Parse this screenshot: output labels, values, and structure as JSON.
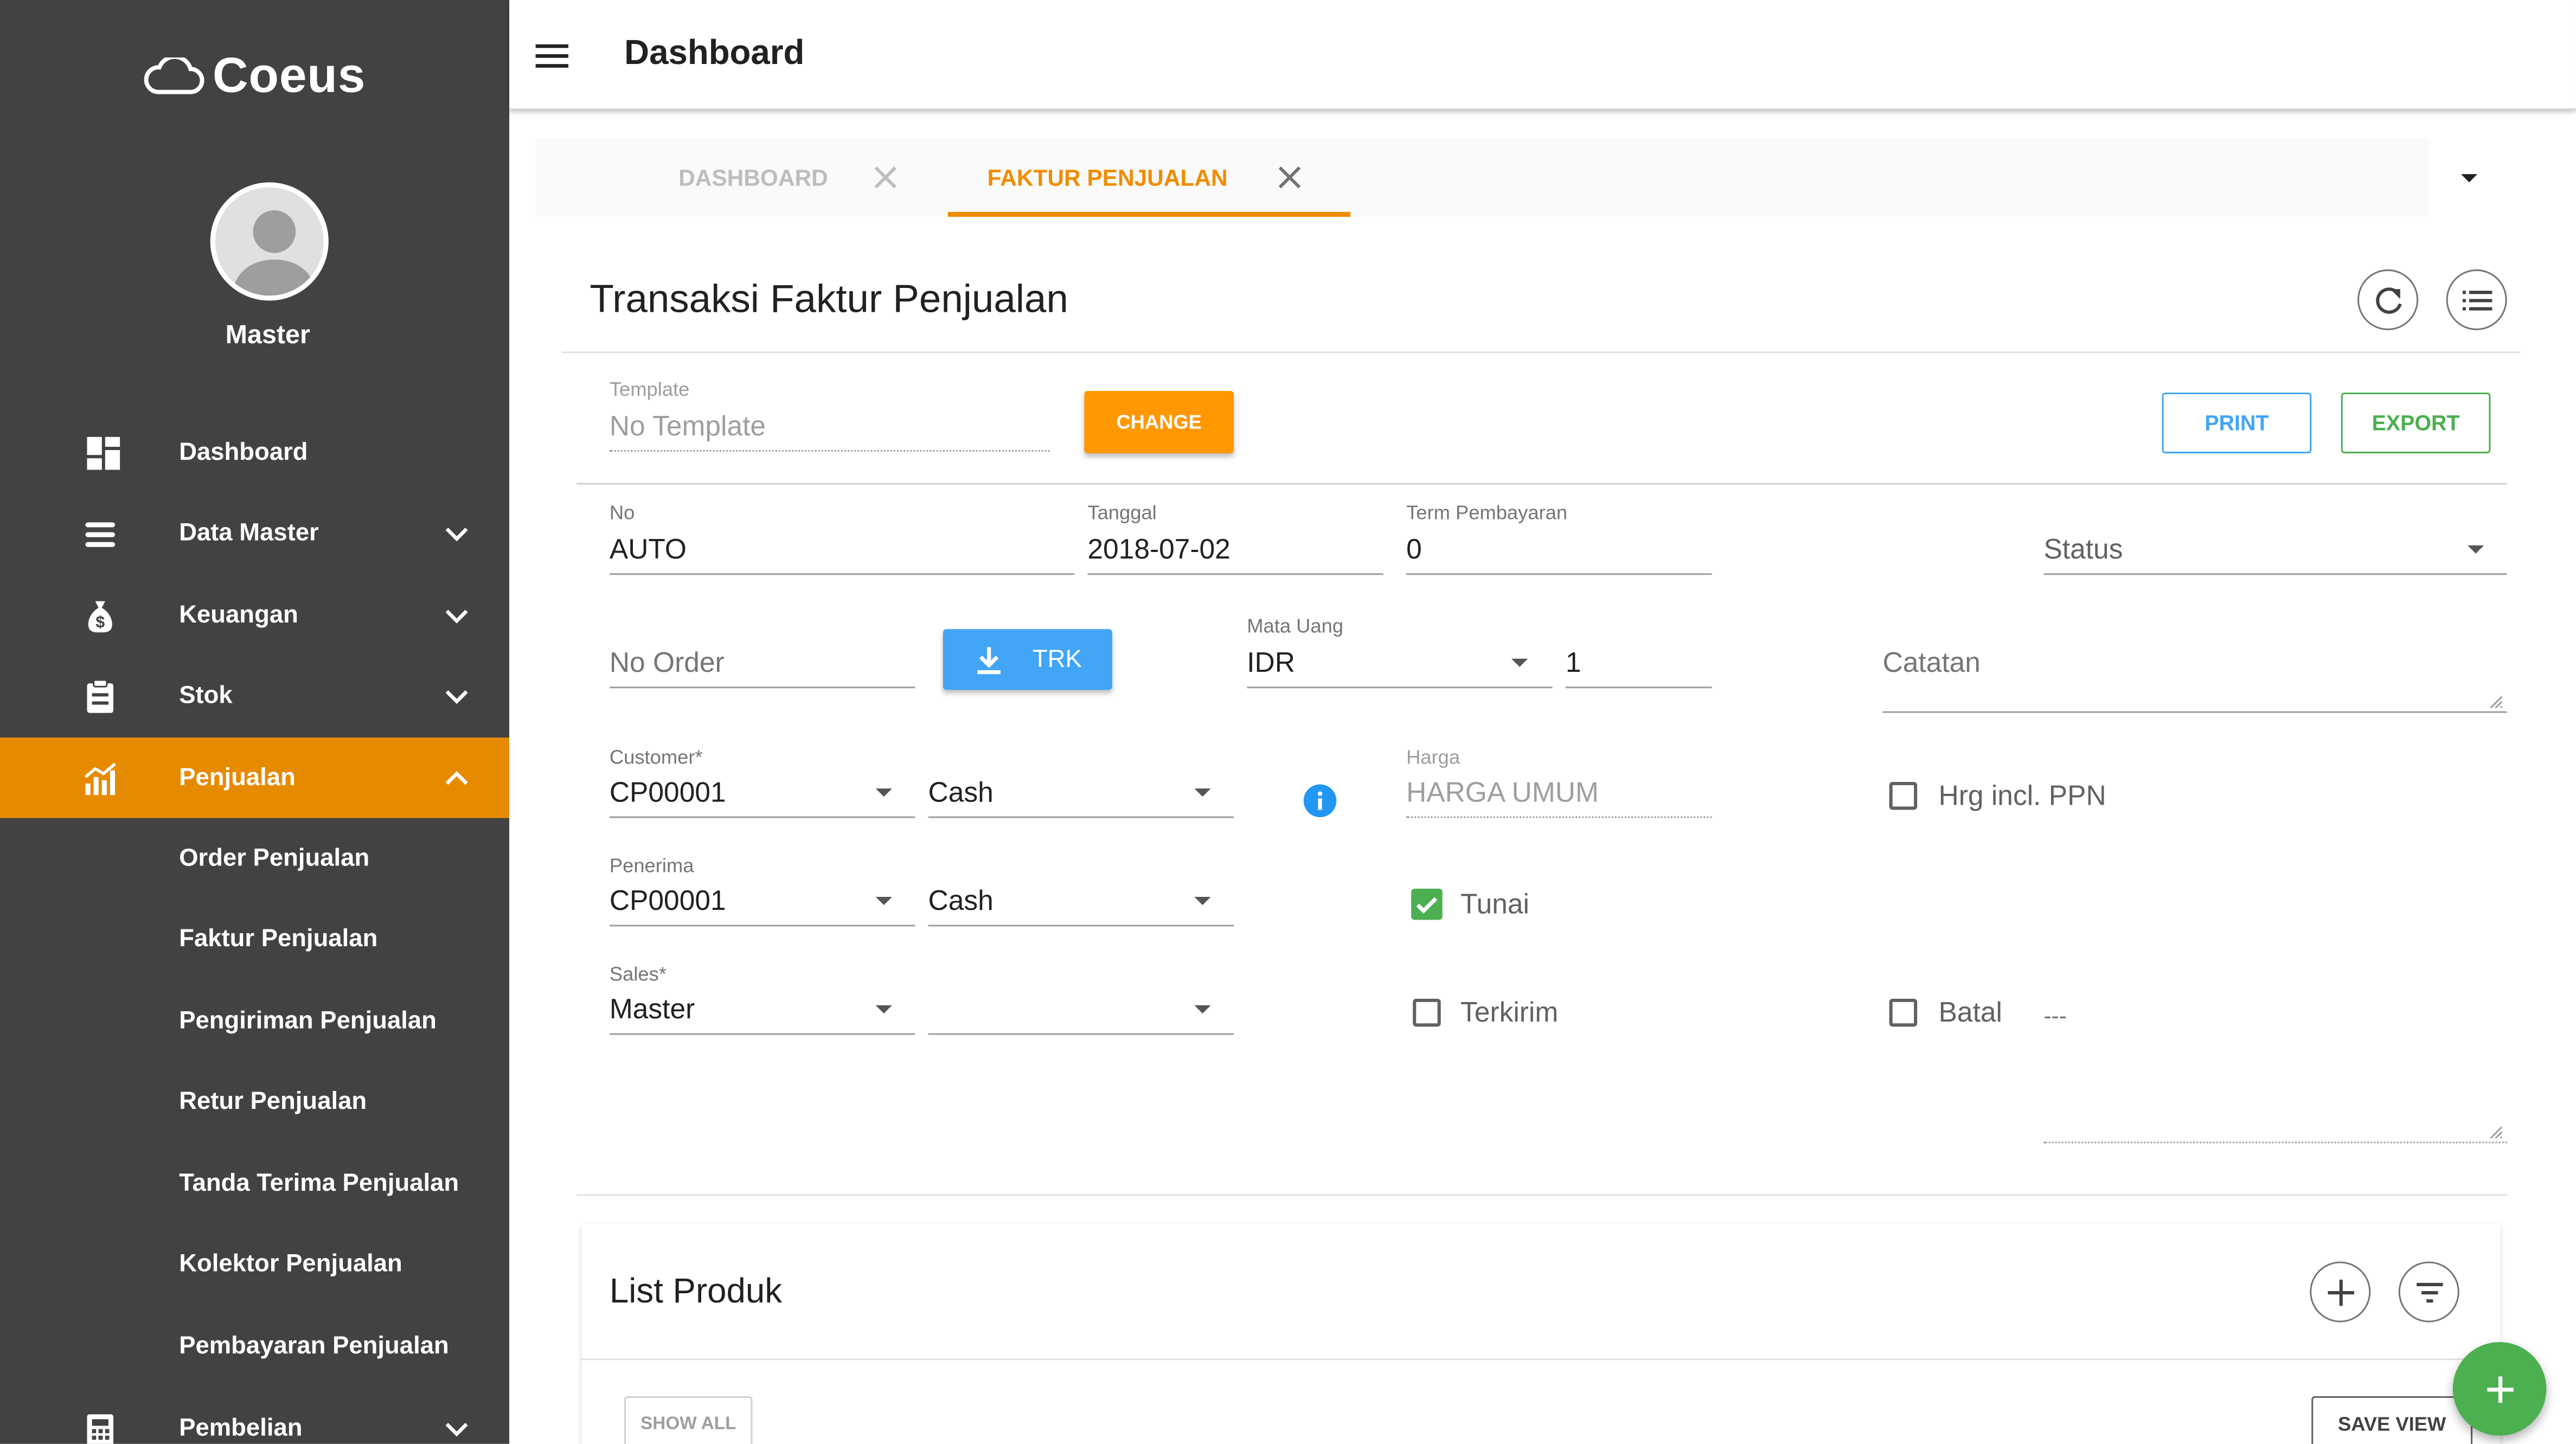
{
  "app": {
    "brand": "Coeus",
    "user": "Master",
    "page_title": "Dashboard"
  },
  "sidebar": {
    "items": [
      {
        "label": "Dashboard",
        "icon": "dashboard-icon"
      },
      {
        "label": "Data Master",
        "icon": "list-icon"
      },
      {
        "label": "Keuangan",
        "icon": "money-bag-icon"
      },
      {
        "label": "Stok",
        "icon": "clipboard-icon"
      },
      {
        "label": "Penjualan",
        "icon": "chart-icon"
      },
      {
        "label": "Pembelian",
        "icon": "calculator-icon"
      }
    ],
    "subitems": [
      "Order Penjualan",
      "Faktur Penjualan",
      "Pengiriman Penjualan",
      "Retur Penjualan",
      "Tanda Terima Penjualan",
      "Kolektor Penjualan",
      "Pembayaran Penjualan"
    ]
  },
  "tabs": [
    {
      "label": "DASHBOARD",
      "active": false
    },
    {
      "label": "FAKTUR PENJUALAN",
      "active": true
    }
  ],
  "form": {
    "title": "Transaksi Faktur Penjualan",
    "template_label": "Template",
    "template_value": "No Template",
    "change_label": "CHANGE",
    "print_label": "PRINT",
    "export_label": "EXPORT",
    "no_label": "No",
    "no_value": "AUTO",
    "tanggal_label": "Tanggal",
    "tanggal_value": "2018-07-02",
    "term_label": "Term Pembayaran",
    "term_value": "0",
    "status_placeholder": "Status",
    "no_order_placeholder": "No Order",
    "trk_label": "TRK",
    "mata_uang_label": "Mata Uang",
    "mata_uang_value": "IDR",
    "kurs_value": "1",
    "catatan_placeholder": "Catatan",
    "customer_label": "Customer*",
    "customer_value": "CP00001",
    "customer_pay": "Cash",
    "harga_label": "Harga",
    "harga_value": "HARGA UMUM",
    "hrg_ppn_label": "Hrg incl. PPN",
    "penerima_label": "Penerima",
    "penerima_value": "CP00001",
    "penerima_pay": "Cash",
    "tunai_label": "Tunai",
    "sales_label": "Sales*",
    "sales_value": "Master",
    "terkirim_label": "Terkirim",
    "batal_label": "Batal",
    "batal_note": "---"
  },
  "list": {
    "title": "List Produk",
    "show_all": "SHOW ALL",
    "save_view": "SAVE VIEW"
  },
  "colors": {
    "sidebar": "#424242",
    "accent": "#e68a00",
    "primary": "#42a5f5",
    "success": "#4caf50"
  }
}
